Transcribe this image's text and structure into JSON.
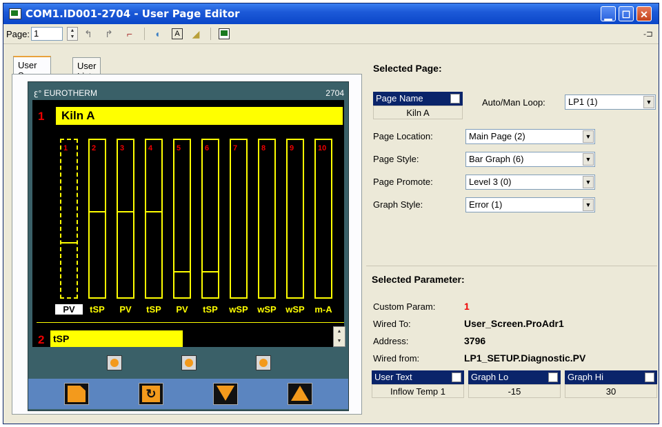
{
  "window": {
    "title": "COM1.ID001-2704 - User Page Editor"
  },
  "toolbar": {
    "page_label": "Page:",
    "page_value": "1"
  },
  "tabs": [
    {
      "label": "User Screen",
      "active": true
    },
    {
      "label": "User List",
      "active": false
    }
  ],
  "device": {
    "brand": "EUROTHERM",
    "model": "2704",
    "line1_number": "1",
    "line1_text": "Kiln A",
    "bars": [
      {
        "num": "1",
        "label": "PV",
        "level": 0.34,
        "selected": true
      },
      {
        "num": "2",
        "label": "tSP",
        "level": 0.54,
        "selected": false
      },
      {
        "num": "3",
        "label": "PV",
        "level": 0.54,
        "selected": false
      },
      {
        "num": "4",
        "label": "tSP",
        "level": 0.54,
        "selected": false
      },
      {
        "num": "5",
        "label": "PV",
        "level": 0.16,
        "selected": false
      },
      {
        "num": "6",
        "label": "tSP",
        "level": 0.16,
        "selected": false
      },
      {
        "num": "7",
        "label": "wSP",
        "level": 0,
        "selected": false
      },
      {
        "num": "8",
        "label": "wSP",
        "level": 0,
        "selected": false
      },
      {
        "num": "9",
        "label": "wSP",
        "level": 0,
        "selected": false
      },
      {
        "num": "10",
        "label": "m-A",
        "level": 0,
        "selected": false
      }
    ],
    "line2_number": "2",
    "line2_text": "tSP",
    "led_color": "#f39a1c",
    "bar_color": "#ffff00"
  },
  "selected_page": {
    "title": "Selected Page:",
    "page_name_header": "Page Name",
    "page_name_value": "Kiln A",
    "auto_man_label": "Auto/Man Loop:",
    "auto_man_value": "LP1 (1)",
    "fields": [
      {
        "label": "Page Location:",
        "value": "Main Page (2)"
      },
      {
        "label": "Page Style:",
        "value": "Bar Graph (6)"
      },
      {
        "label": "Page Promote:",
        "value": "Level 3 (0)"
      },
      {
        "label": "Graph Style:",
        "value": "Error (1)"
      }
    ]
  },
  "selected_parameter": {
    "title": "Selected Parameter:",
    "rows": [
      {
        "label": "Custom Param:",
        "value": "1"
      },
      {
        "label": "Wired To:",
        "value": "User_Screen.ProAdr1"
      },
      {
        "label": "Address:",
        "value": "3796"
      },
      {
        "label": "Wired from:",
        "value": "LP1_SETUP.Diagnostic.PV"
      }
    ],
    "grid": [
      {
        "header": "User Text",
        "value": "Inflow Temp 1"
      },
      {
        "header": "Graph Lo",
        "value": "-15"
      },
      {
        "header": "Graph Hi",
        "value": "30"
      }
    ]
  }
}
